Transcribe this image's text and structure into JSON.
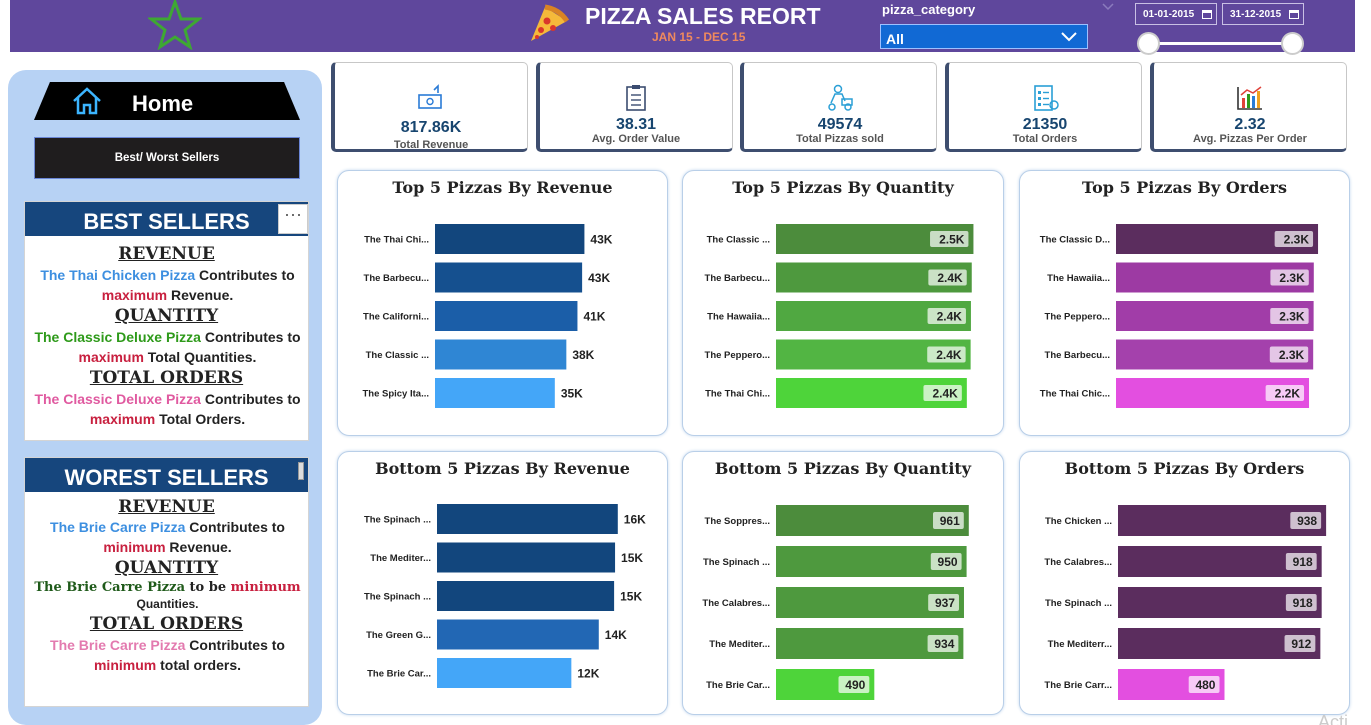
{
  "header": {
    "title": "PIZZA SALES REORT",
    "subtitle": "JAN 15 - DEC 15",
    "slicer_label": "pizza_category",
    "slicer_value": "All",
    "date_start": "01-01-2015",
    "date_end": "31-12-2015",
    "date_range_fraction": [
      0,
      1
    ],
    "icons": {
      "star": "star-icon",
      "pizza": "pizza-slice-icon",
      "calendar": "calendar-icon"
    }
  },
  "sidebar": {
    "home_label": "Home",
    "best_worst_label": "Best/ Worst Sellers",
    "best": {
      "title": "BEST SELLERS",
      "more": "···",
      "revenue_title": "REVENUE",
      "revenue_pizza": "The Thai Chicken Pizza",
      "revenue_mid": " Contributes to",
      "revenue_strong": "maximum",
      "revenue_end": " Revenue.",
      "quantity_title": "QUANTITY",
      "quantity_pizza": "The Classic Deluxe Pizza",
      "quantity_mid": " Contributes to",
      "quantity_strong": "maximum",
      "quantity_end": " Total Quantities.",
      "orders_title": "TOTAL ORDERS",
      "orders_pizza": "The Classic Deluxe Pizza",
      "orders_mid": " Contributes to",
      "orders_strong": "maximum",
      "orders_end": " Total Orders."
    },
    "worst": {
      "title": "WOREST SELLERS",
      "revenue_title": "REVENUE",
      "revenue_pizza": "The Brie Carre Pizza",
      "revenue_mid": " Contributes to",
      "revenue_strong": "minimum",
      "revenue_end": " Revenue.",
      "quantity_title": "QUANTITY",
      "quantity_pizza": "The Brie Carre Pizza",
      "quantity_mid": " to be ",
      "quantity_strong": "minimum",
      "quantity_end": "Quantities.",
      "orders_title": "TOTAL ORDERS",
      "orders_pizza": "The Brie Carre Pizza",
      "orders_mid": " Contributes to",
      "orders_strong": "minimum",
      "orders_end": " total orders."
    }
  },
  "kpis": [
    {
      "value": "817.86K",
      "label": "Total Revenue",
      "icon": "money-icon"
    },
    {
      "value": "38.31",
      "label": "Avg. Order Value",
      "icon": "clipboard-icon"
    },
    {
      "value": "49574",
      "label": "Total Pizzas sold",
      "icon": "delivery-icon"
    },
    {
      "value": "21350",
      "label": "Total Orders",
      "icon": "order-list-icon"
    },
    {
      "value": "2.32",
      "label": "Avg. Pizzas Per Order",
      "icon": "bar-chart-icon"
    }
  ],
  "watermark": "Acti",
  "chart_data": [
    {
      "type": "bar",
      "orientation": "horizontal",
      "title": "Top 5 Pizzas By Revenue",
      "categories": [
        "The Thai Chi...",
        "The Barbecu...",
        "The Californi...",
        "The Classic ...",
        "The Spicy Ita..."
      ],
      "values": [
        43434,
        42768,
        41410,
        38180,
        34831
      ],
      "labels": [
        "43K",
        "43K",
        "41K",
        "38K",
        "35K"
      ],
      "colors": [
        "#12467d",
        "#15508f",
        "#1b5ea8",
        "#2f86d4",
        "#44a6f8"
      ],
      "label_style": "outside",
      "xlim": [
        0,
        50000
      ]
    },
    {
      "type": "bar",
      "orientation": "horizontal",
      "title": "Top 5 Pizzas By Quantity",
      "categories": [
        "The Classic ...",
        "The Barbecu...",
        "The Hawaiia...",
        "The Peppero...",
        "The Thai Chi..."
      ],
      "values": [
        2453,
        2432,
        2422,
        2418,
        2371
      ],
      "labels": [
        "2.5K",
        "2.4K",
        "2.4K",
        "2.4K",
        "2.4K"
      ],
      "colors": [
        "#4c8c3c",
        "#4e993e",
        "#50a841",
        "#52b543",
        "#4ed43a"
      ],
      "label_style": "inside",
      "xlim": [
        0,
        2460
      ]
    },
    {
      "type": "bar",
      "orientation": "horizontal",
      "title": "Top 5 Pizzas By Orders",
      "categories": [
        "The Classic D...",
        "The Hawaiia...",
        "The Peppero...",
        "The Barbecu...",
        "The Thai Chic..."
      ],
      "values": [
        2329,
        2280,
        2278,
        2273,
        2225
      ],
      "labels": [
        "2.3K",
        "2.3K",
        "2.3K",
        "2.3K",
        "2.2K"
      ],
      "colors": [
        "#5b2d5e",
        "#9d3aa3",
        "#a13da8",
        "#a441ac",
        "#e34fe0"
      ],
      "label_style": "inside",
      "xlim": [
        0,
        2340
      ]
    },
    {
      "type": "bar",
      "orientation": "horizontal",
      "title": "Bottom 5 Pizzas By Revenue",
      "categories": [
        "The Spinach ...",
        "The Mediter...",
        "The Spinach ...",
        "The Green G...",
        "The Brie Car..."
      ],
      "values": [
        15596,
        15360,
        15278,
        13956,
        11589
      ],
      "labels": [
        "16K",
        "15K",
        "15K",
        "14K",
        "12K"
      ],
      "colors": [
        "#12467d",
        "#12467d",
        "#12467d",
        "#2267b4",
        "#44a6f8"
      ],
      "label_style": "outside",
      "xlim": [
        0,
        15700
      ]
    },
    {
      "type": "bar",
      "orientation": "horizontal",
      "title": "Bottom 5 Pizzas By Quantity",
      "categories": [
        "The Soppres...",
        "The Spinach ...",
        "The Calabres...",
        "The Mediter...",
        "The Brie Car..."
      ],
      "values": [
        961,
        950,
        937,
        934,
        490
      ],
      "labels": [
        "961",
        "950",
        "937",
        "934",
        "490"
      ],
      "colors": [
        "#4c8c3c",
        "#4e993e",
        "#4e993e",
        "#4e993e",
        "#4ed43a"
      ],
      "label_style": "inside",
      "xlim": [
        0,
        967
      ]
    },
    {
      "type": "bar",
      "orientation": "horizontal",
      "title": "Bottom 5 Pizzas By Orders",
      "categories": [
        "The Chicken ...",
        "The Calabres...",
        "The Spinach ...",
        "The Mediterr...",
        "The Brie Carr..."
      ],
      "values": [
        938,
        918,
        918,
        912,
        480
      ],
      "labels": [
        "938",
        "918",
        "918",
        "912",
        "480"
      ],
      "colors": [
        "#5b2d5e",
        "#5b2d5e",
        "#5b2d5e",
        "#5b2d5e",
        "#e34fe0"
      ],
      "label_style": "inside",
      "xlim": [
        0,
        942
      ]
    }
  ]
}
